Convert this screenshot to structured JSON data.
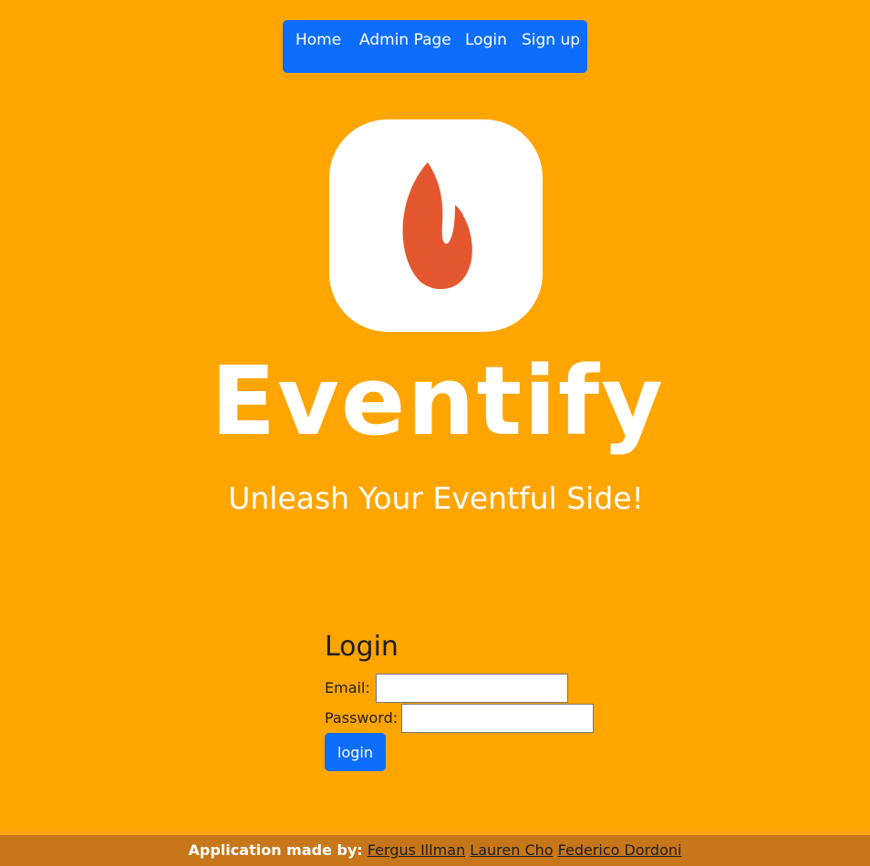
{
  "nav": {
    "items": [
      {
        "label": "Home"
      },
      {
        "label": "Admin Page"
      },
      {
        "label": "Login"
      },
      {
        "label": "Sign up"
      }
    ]
  },
  "brand": {
    "name": "Eventify",
    "tagline": "Unleash Your Eventful Side!",
    "icon": "flame-icon",
    "flame_color": "#e4572e"
  },
  "login": {
    "title": "Login",
    "email_label": "Email:",
    "email_value": "",
    "password_label": "Password:",
    "password_value": "",
    "submit_label": "login"
  },
  "footer": {
    "label": "Application made by:",
    "authors": [
      "Fergus Illman",
      "Lauren Cho",
      "Federico Dordoni"
    ]
  },
  "colors": {
    "background": "#ffa500",
    "accent": "#0d6efd",
    "footer": "#c77619"
  }
}
